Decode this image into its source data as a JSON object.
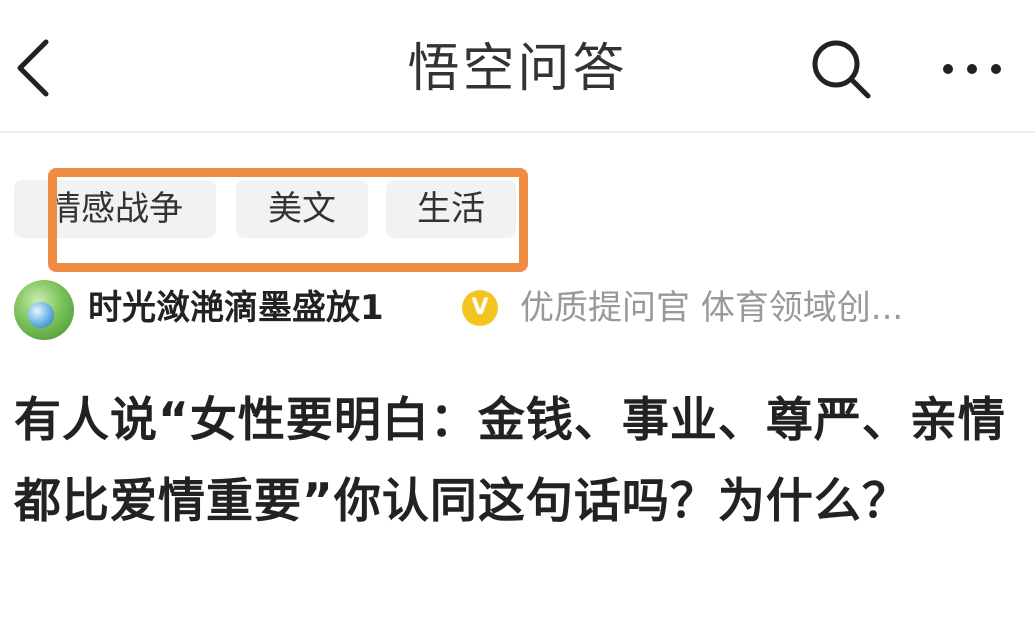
{
  "header": {
    "title": "悟空问答",
    "back_icon": "chevron-left-icon",
    "search_icon": "search-icon",
    "more_icon": "more-horizontal-icon"
  },
  "tags": [
    "情感战争",
    "美文",
    "生活"
  ],
  "highlight_color": "#ef8c43",
  "author": {
    "name": "时光潋滟滴墨盛放1",
    "badge": "V",
    "description": "优质提问官 体育领域创..."
  },
  "question": "有人说“女性要明白：金钱、事业、尊严、亲情都比爱情重要”你认同这句话吗？为什么？"
}
